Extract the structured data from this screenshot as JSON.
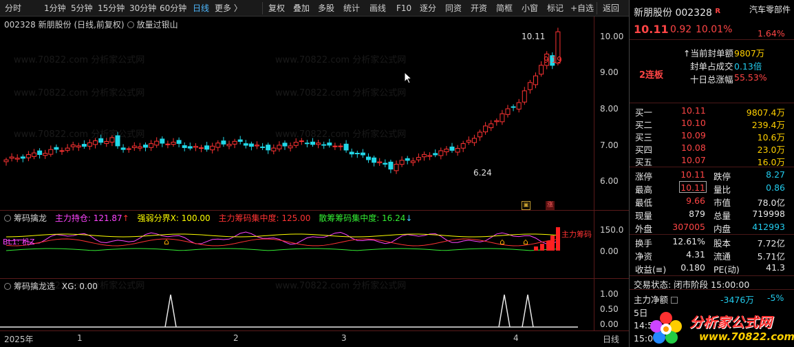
{
  "toolbar": {
    "periods": [
      "分时",
      "1分钟",
      "5分钟",
      "15分钟",
      "30分钟",
      "60分钟",
      "日线",
      "更多 〉"
    ],
    "tools": [
      "复权",
      "叠加",
      "多股",
      "统计",
      "画线",
      "F10",
      "逐分",
      "同资",
      "开资",
      "简框",
      "小窗",
      "标记",
      "+自选",
      "返回"
    ]
  },
  "main_panel": {
    "title": "002328 新朋股份 (日线,前复权)",
    "indicator": "放量过银山",
    "y_ticks": [
      "10.00",
      "9.00",
      "8.00",
      "7.00",
      "6.00"
    ],
    "label_high": "10.11",
    "label_prev": "9.19",
    "label_low": "6.24"
  },
  "panel2": {
    "name": "筹码擒龙",
    "items": [
      {
        "text": "主力持仓: 121.87",
        "arrow": "↑",
        "color": "#ff44ff"
      },
      {
        "text": "强弱分界X: 100.00",
        "color": "#ffff00"
      },
      {
        "text": "主力筹码集中度: 125.00",
        "color": "#ff3333"
      },
      {
        "text": "散筹筹码集中度: 16.24",
        "arrow": "↓",
        "color": "#33ee33"
      }
    ],
    "y_ticks": [
      "150.0",
      "0.00"
    ],
    "left_label": "BL1: 机Z",
    "right_label": "主力筹码"
  },
  "panel3": {
    "name": "筹码擒龙选",
    "xg": "XG: 0.00",
    "y_ticks": [
      "1.00",
      "0.50",
      "0.00"
    ]
  },
  "date_axis": {
    "labels": [
      "2025年",
      "1",
      "2",
      "3",
      "4",
      "日线"
    ]
  },
  "watermark": {
    "text": "www.70822.com 分析家公式网"
  },
  "right": {
    "stock_name": "新朋股份",
    "stock_code": "002328",
    "r_badge": "R",
    "sector": "汽车零部件",
    "price": "10.11",
    "change": "0.92",
    "change_pct": "10.01%",
    "sector_pct": "1.64%",
    "seal_amount_label": "↑当前封单额",
    "seal_amount": "9807万",
    "seal_ratio_label": "封单占成交",
    "seal_ratio": "0.13倍",
    "ten_day_label": "十日总涨幅",
    "ten_day": "55.53%",
    "streak": "2连板",
    "bids": [
      {
        "label": "买一",
        "price": "10.11",
        "vol": "9807.4万"
      },
      {
        "label": "买二",
        "price": "10.10",
        "vol": "239.4万"
      },
      {
        "label": "买三",
        "price": "10.09",
        "vol": "10.6万"
      },
      {
        "label": "买四",
        "price": "10.08",
        "vol": "23.0万"
      },
      {
        "label": "买五",
        "price": "10.07",
        "vol": "16.0万"
      }
    ],
    "stats": [
      {
        "l1": "涨停",
        "v1": "10.11",
        "c1": "red",
        "l2": "跌停",
        "v2": "8.27",
        "c2": "cyan"
      },
      {
        "l1": "最高",
        "v1": "10.11",
        "c1": "red",
        "l2": "量比",
        "v2": "0.86",
        "c2": "cyan"
      },
      {
        "l1": "最低",
        "v1": "9.66",
        "c1": "red",
        "l2": "市值",
        "v2": "78.0亿",
        "c2": "white"
      },
      {
        "l1": "现量",
        "v1": "879",
        "c1": "white",
        "l2": "总量",
        "v2": "719998",
        "c2": "white"
      },
      {
        "l1": "外盘",
        "v1": "307005",
        "c1": "red",
        "l2": "内盘",
        "v2": "412993",
        "c2": "cyan"
      }
    ],
    "stats2": [
      {
        "l1": "换手",
        "v1": "12.61%",
        "l2": "股本",
        "v2": "7.72亿"
      },
      {
        "l1": "净资",
        "v1": "4.31",
        "l2": "流通",
        "v2": "5.71亿"
      },
      {
        "l1": "收益(≡)",
        "v1": "0.180",
        "l2": "PE(动)",
        "v2": "41.3"
      }
    ],
    "trade_status": "交易状态: 闭市阶段 15:00:00",
    "main_flow_label": "主力净额",
    "main_flow_value": "-3476万",
    "main_flow_pct": "-5%",
    "day_label": "5日",
    "time1": "14:5",
    "time2": "15:0"
  },
  "logo": {
    "text": "分析家公式网",
    "url": "www.70822.com"
  },
  "colors": {
    "up": "#ff3333",
    "down": "#22d8e8",
    "active_tab": "#4db8ff",
    "grid": "#5a1a1a"
  }
}
